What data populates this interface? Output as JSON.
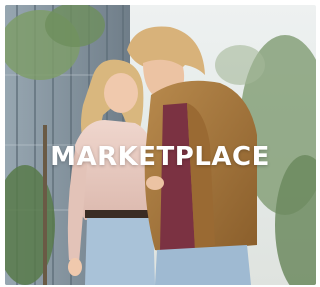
{
  "headline": "MARKETPLACE",
  "colors": {
    "sky": "#eef1f1",
    "building": "#8a99a6",
    "foliage": "#7a9a6a",
    "jacket": "#a9783d",
    "sweater": "#e8c9bf",
    "jeans": "#a9c2d8",
    "headline_text": "#ffffff"
  }
}
